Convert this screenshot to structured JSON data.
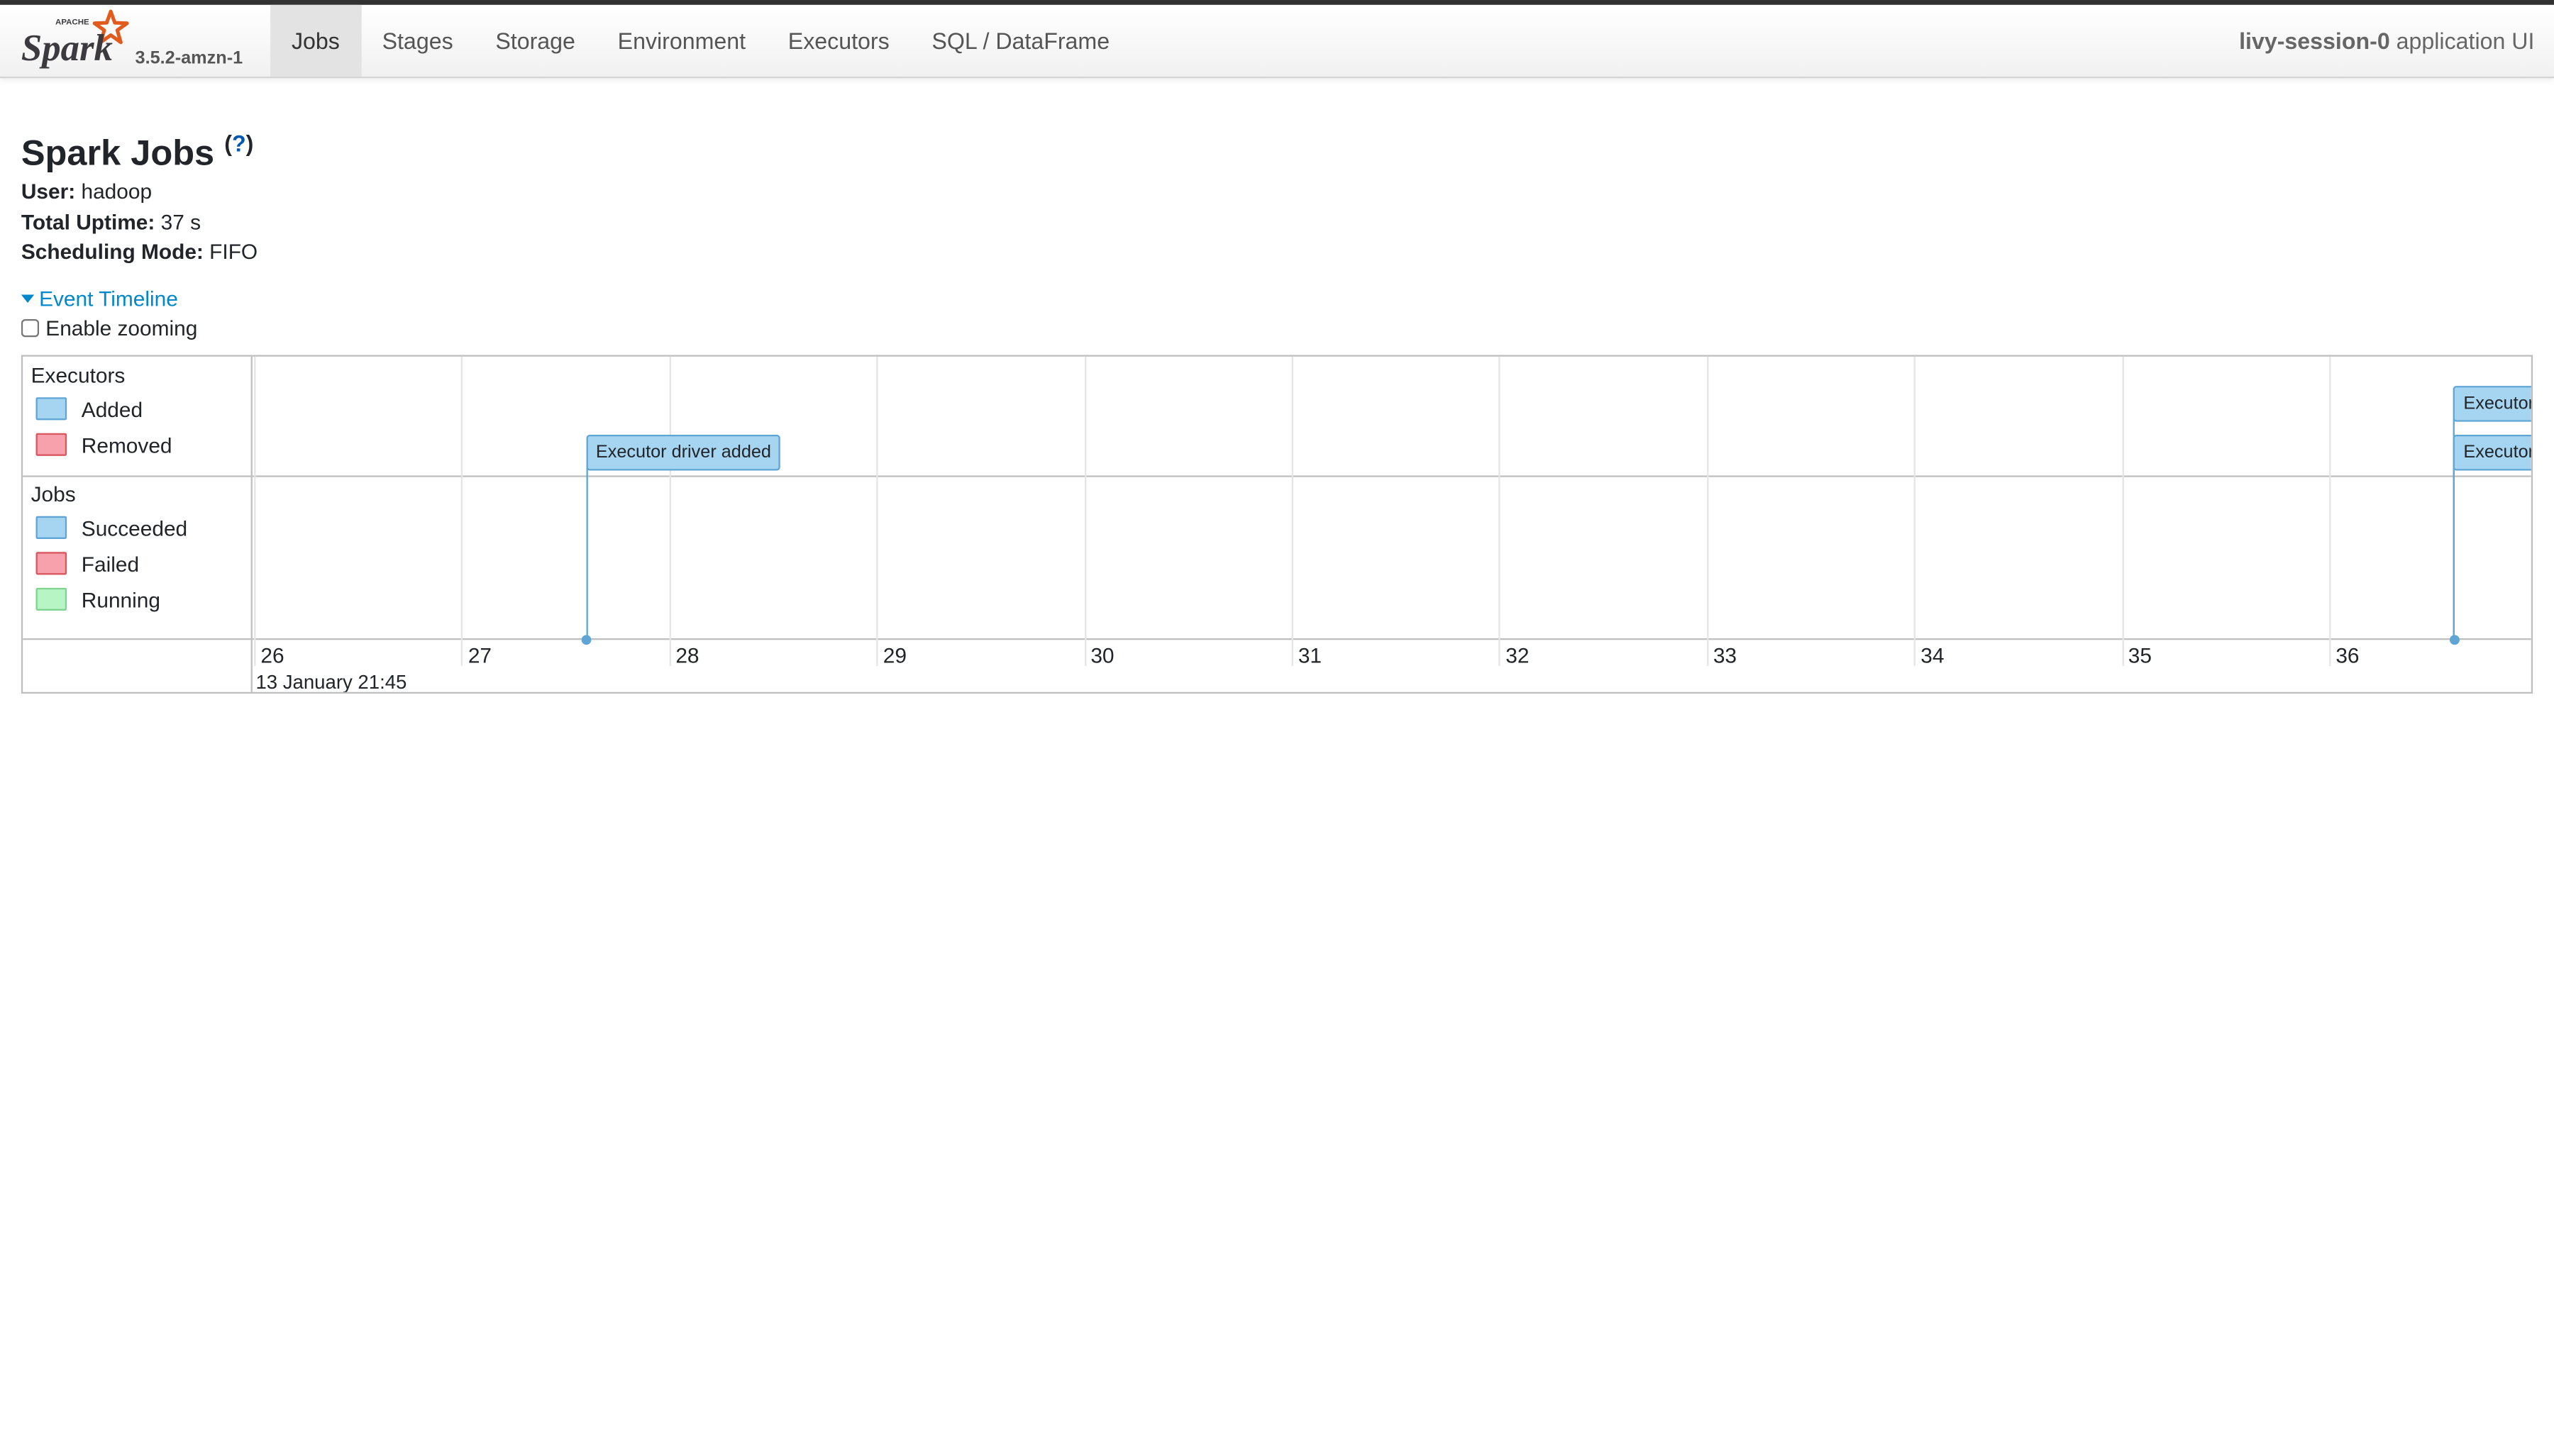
{
  "brand": {
    "logo_alt": "Apache Spark",
    "version": "3.5.2-amzn-1"
  },
  "nav": {
    "tabs": [
      {
        "label": "Jobs",
        "active": true
      },
      {
        "label": "Stages",
        "active": false
      },
      {
        "label": "Storage",
        "active": false
      },
      {
        "label": "Environment",
        "active": false
      },
      {
        "label": "Executors",
        "active": false
      },
      {
        "label": "SQL / DataFrame",
        "active": false
      }
    ],
    "app_name": "livy-session-0",
    "app_suffix": " application UI"
  },
  "page": {
    "title": "Spark Jobs",
    "help": "?",
    "summary": {
      "user_label": "User:",
      "user": " hadoop",
      "uptime_label": "Total Uptime:",
      "uptime": " 37 s",
      "mode_label": "Scheduling Mode:",
      "mode": " FIFO"
    },
    "timeline_toggle": "Event Timeline",
    "zoom_label": "Enable zooming",
    "zoom_checked": false
  },
  "timeline": {
    "legend": {
      "executors_title": "Executors",
      "executors": [
        {
          "label": "Added",
          "fill": "#a6d5f2",
          "border": "#5fa6d6"
        },
        {
          "label": "Removed",
          "fill": "#f7a1ad",
          "border": "#d9575e"
        }
      ],
      "jobs_title": "Jobs",
      "jobs": [
        {
          "label": "Succeeded",
          "fill": "#a6d5f2",
          "border": "#5fa6d6"
        },
        {
          "label": "Failed",
          "fill": "#f7a1ad",
          "border": "#d9575e"
        },
        {
          "label": "Running",
          "fill": "#b8f5c5",
          "border": "#7fd38f"
        }
      ]
    },
    "axis": {
      "ticks": [
        "26",
        "27",
        "28",
        "29",
        "30",
        "31",
        "32",
        "33",
        "34",
        "35",
        "36"
      ],
      "major_label": "13 January 21:45"
    },
    "events": [
      {
        "label": "Executor driver added",
        "second": 27.6
      },
      {
        "label": "Executor",
        "second": 36.6
      },
      {
        "label": "Executor",
        "second": 36.6
      }
    ]
  }
}
